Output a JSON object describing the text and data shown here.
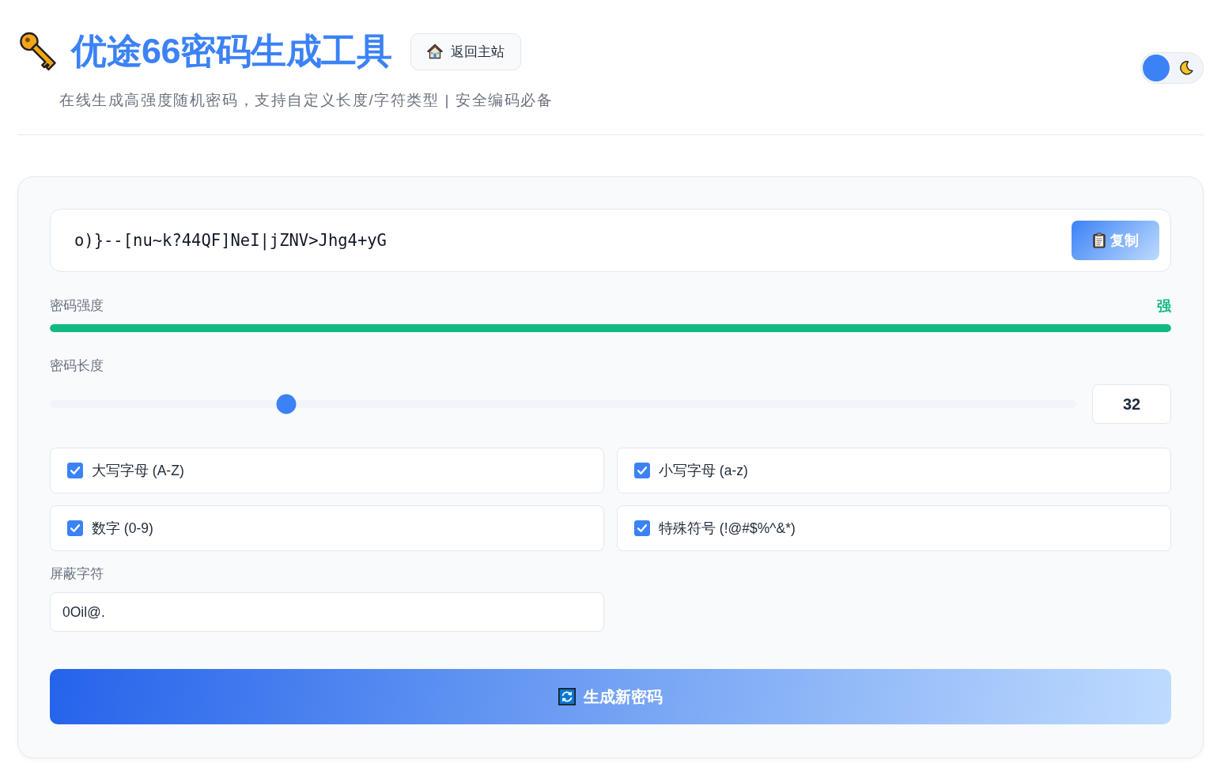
{
  "header": {
    "title": "优途66密码生成工具",
    "home_button": "返回主站",
    "subtitle": "在线生成高强度随机密码，支持自定义长度/字符类型 | 安全编码必备",
    "theme_toggle": {
      "dark": false
    }
  },
  "password": {
    "value": "o)}--[nu~k?44QF]NeI|jZNV>Jhg4+yG",
    "copy_button": "复制"
  },
  "strength": {
    "label": "密码强度",
    "rating": "强",
    "level": 1
  },
  "length": {
    "label": "密码长度",
    "level": 0.23,
    "value": "32"
  },
  "options": [
    {
      "label": "大写字母 (A-Z)",
      "checked": true
    },
    {
      "label": "小写字母 (a-z)",
      "checked": true
    },
    {
      "label": "数字 (0-9)",
      "checked": true
    },
    {
      "label": "特殊符号 (!@#$%^&*)",
      "checked": true
    }
  ],
  "excluded": {
    "label": "屏蔽字符",
    "value": "0Oil@."
  },
  "generate_button": "生成新密码"
}
